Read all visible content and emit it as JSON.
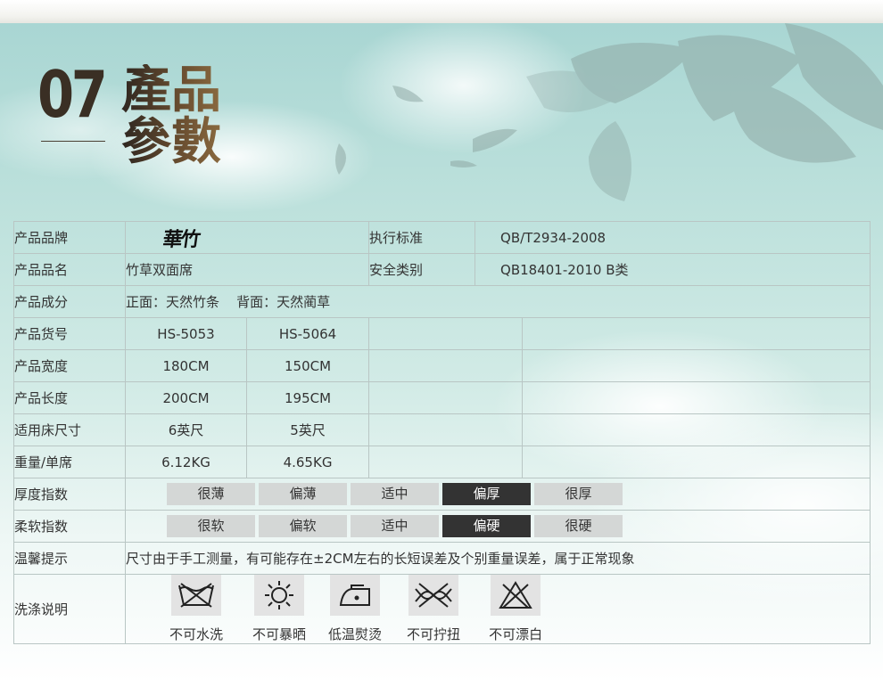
{
  "section": {
    "number": "07",
    "title_line1": "產品",
    "title_line2": "參數"
  },
  "brand_logo": {
    "text": "華竹"
  },
  "rows": {
    "brand": {
      "label": "产品品牌",
      "std_label": "执行标准",
      "std_value": "QB/T2934-2008"
    },
    "name": {
      "label": "产品品名",
      "value": "竹草双面席",
      "safety_label": "安全类别",
      "safety_value": "QB18401-2010 B类"
    },
    "material": {
      "label": "产品成分",
      "value": "正面：天然竹条    背面：天然蔺草"
    },
    "sku": {
      "label": "产品货号",
      "values": [
        "HS-5053",
        "HS-5064"
      ]
    },
    "width": {
      "label": "产品宽度",
      "values": [
        "180CM",
        "150CM"
      ]
    },
    "length": {
      "label": "产品长度",
      "values": [
        "200CM",
        "195CM"
      ]
    },
    "bed": {
      "label": "适用床尺寸",
      "values": [
        "6英尺",
        "5英尺"
      ]
    },
    "weight": {
      "label": "重量/单席",
      "values": [
        "6.12KG",
        "4.65KG"
      ]
    },
    "thickness": {
      "label": "厚度指数",
      "options": [
        "很薄",
        "偏薄",
        "适中",
        "偏厚",
        "很厚"
      ],
      "selected": "偏厚"
    },
    "softness": {
      "label": "柔软指数",
      "options": [
        "很软",
        "偏软",
        "适中",
        "偏硬",
        "很硬"
      ],
      "selected": "偏硬"
    },
    "tip": {
      "label": "温馨提示",
      "value": "尺寸由于手工测量，有可能存在±2CM左右的长短误差及个别重量误差，属于正常现象"
    },
    "care": {
      "label": "洗涤说明",
      "items": [
        {
          "icon": "no-wash-icon",
          "text": "不可水洗"
        },
        {
          "icon": "no-sun-icon",
          "text": "不可暴晒"
        },
        {
          "icon": "low-iron-icon",
          "text": "低温熨烫"
        },
        {
          "icon": "no-wring-icon",
          "text": "不可拧扭"
        },
        {
          "icon": "no-bleach-icon",
          "text": "不可漂白"
        }
      ]
    }
  },
  "colors": {
    "selected_bg": "#333333",
    "option_bg": "#d4d7d6",
    "border": "#b9c6c4"
  }
}
